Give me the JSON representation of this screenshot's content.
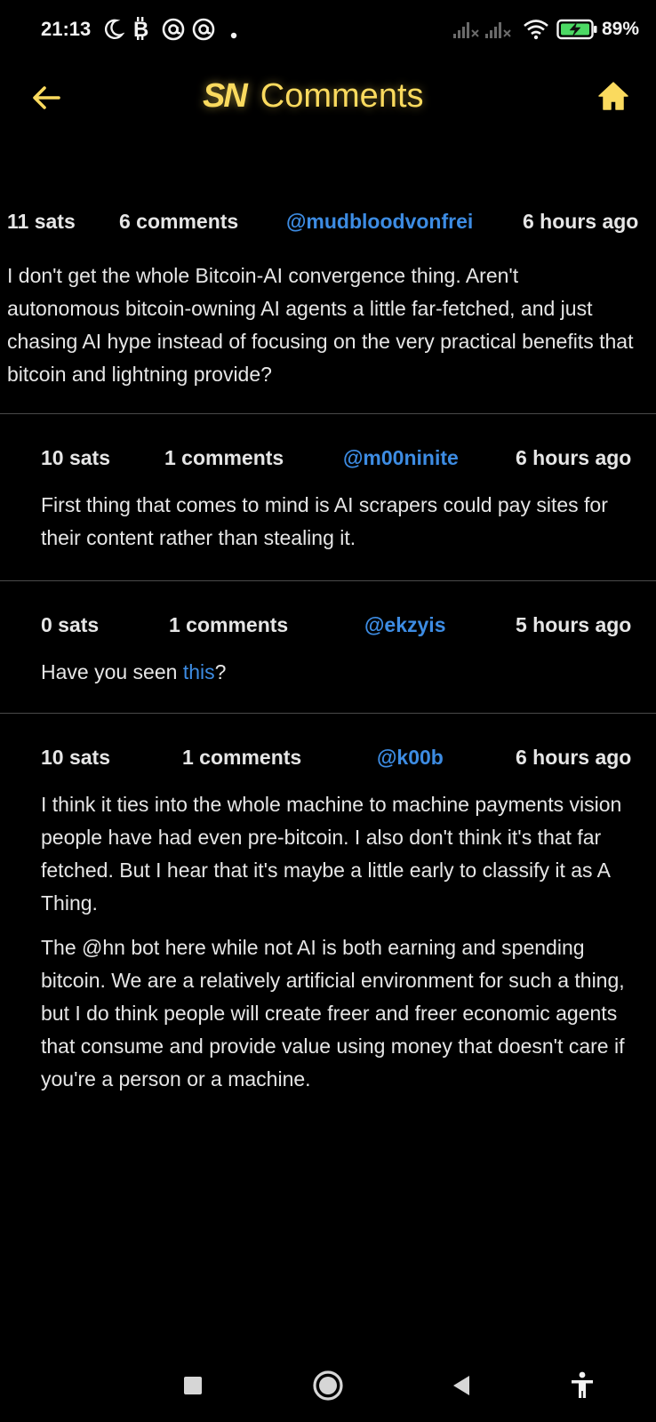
{
  "status_bar": {
    "time": "21:13",
    "battery_percent": "89%",
    "icons": [
      "moon-icon",
      "bitcoin-icon",
      "at-icon",
      "at-icon",
      "dot-icon",
      "signal-icon",
      "signal-icon",
      "wifi-icon",
      "battery-charging-icon"
    ]
  },
  "header": {
    "logo_text": "SN",
    "title": "Comments",
    "accent_color": "#fada5e"
  },
  "comments": [
    {
      "sats": "11 sats",
      "comments_count": "6 comments",
      "user": "@mudbloodvonfrei",
      "time": "6 hours ago",
      "paragraphs": [
        "I don't get the whole Bitcoin-AI convergence thing. Aren't autonomous bitcoin-owning AI agents a little far-fetched, and just chasing AI hype instead of focusing on the very practical benefits that bitcoin and lightning provide?"
      ]
    },
    {
      "sats": "10 sats",
      "comments_count": "1 comments",
      "user": "@m00ninite",
      "time": "6 hours ago",
      "paragraphs": [
        "First thing that comes to mind is AI scrapers could pay sites for their content rather than stealing it."
      ]
    },
    {
      "sats": "0 sats",
      "comments_count": "1 comments",
      "user": "@ekzyis",
      "time": "5 hours ago",
      "text_before_link": "Have you seen ",
      "link_text": "this",
      "text_after_link": "?"
    },
    {
      "sats": "10 sats",
      "comments_count": "1 comments",
      "user": "@k00b",
      "time": "6 hours ago",
      "paragraphs": [
        "I think it ties into the whole machine to machine payments vision people have had even pre-bitcoin. I also don't think it's that far fetched. But I hear that it's maybe a little early to classify it as A Thing.",
        "The @hn bot here while not AI is both earning and spending bitcoin. We are a relatively artificial environment for such a thing, but I do think people will create freer and freer economic agents that consume and provide value using money that doesn't care if you're a person or a machine."
      ]
    }
  ],
  "nav_bar": {
    "icons": [
      "square-recents-icon",
      "circle-home-icon",
      "triangle-back-icon",
      "accessibility-icon"
    ]
  }
}
